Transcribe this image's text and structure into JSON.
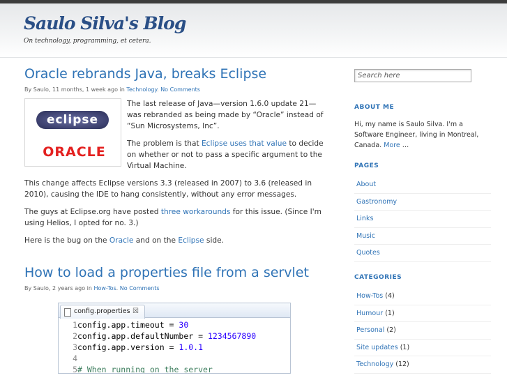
{
  "blog": {
    "title": "Saulo Silva's Blog",
    "tagline": "On technology, programming, et cetera."
  },
  "posts": [
    {
      "title": "Oracle rebrands Java, breaks Eclipse",
      "meta_prefix": "By Saulo, 11 months, 1 week ago in ",
      "category": "Technology",
      "sep": ". ",
      "comments": "No Comments",
      "logo_eclipse": "eclipse",
      "logo_oracle": "ORACLE",
      "p1": "The last release of Java—version 1.6.0 update 21—was rebranded as being made by “Oracle” instead of “Sun Microsystems, Inc”.",
      "p2_before": "The problem is that ",
      "p2_link": "Eclipse uses that value",
      "p2_after": " to decide on whether or not to pass a specific argument to the Virtual Machine.",
      "p3": "This change affects Eclipse versions 3.3 (released in 2007) to 3.6 (released in 2010), causing the IDE to hang consistently, without any error messages.",
      "p4_before": "The guys at Eclipse.org have posted ",
      "p4_link": "three workarounds",
      "p4_after": " for this issue. (Since I'm using Helios, I opted for no. 3.)",
      "p5_before": "Here is the bug  on the ",
      "p5_link1": "Oracle",
      "p5_mid": " and on the ",
      "p5_link2": "Eclipse",
      "p5_after": " side."
    },
    {
      "title": "How to load a properties file from a servlet",
      "meta_prefix": "By Saulo, 2 years ago in ",
      "category": "How-Tos",
      "sep": ". ",
      "comments": "No Comments",
      "code": {
        "tab_label": "config.properties",
        "close_glyph": "☒",
        "lines": [
          {
            "n": "1",
            "key": "config.app.timeout = ",
            "val": "30"
          },
          {
            "n": "2",
            "key": "config.app.defaultNumber = ",
            "val": "1234567890"
          },
          {
            "n": "3",
            "key": "config.app.version = ",
            "val": "1.0.1"
          },
          {
            "n": "4",
            "key": "",
            "val": ""
          },
          {
            "n": "5",
            "comment": "# When running on the server"
          }
        ]
      }
    }
  ],
  "sidebar": {
    "search_placeholder": "Search here",
    "about_title": "ABOUT ME",
    "about_text": "Hi, my name is Saulo Silva. I'm a Software Engineer, living in Montreal, Canada. ",
    "about_more": "More",
    "about_ellipsis": " …",
    "pages_title": "PAGES",
    "pages": [
      "About",
      "Gastronomy",
      "Links",
      "Music",
      "Quotes"
    ],
    "categories_title": "CATEGORIES",
    "categories": [
      {
        "name": "How-Tos",
        "count": " (4)"
      },
      {
        "name": "Humour",
        "count": " (1)"
      },
      {
        "name": "Personal",
        "count": " (2)"
      },
      {
        "name": "Site updates",
        "count": " (1)"
      },
      {
        "name": "Technology",
        "count": " (12)"
      }
    ]
  },
  "colors": {
    "link": "#2f73b6",
    "title": "#2a4f86",
    "oracle_red": "#e3201f",
    "eclipse_band": "#3d416f"
  }
}
